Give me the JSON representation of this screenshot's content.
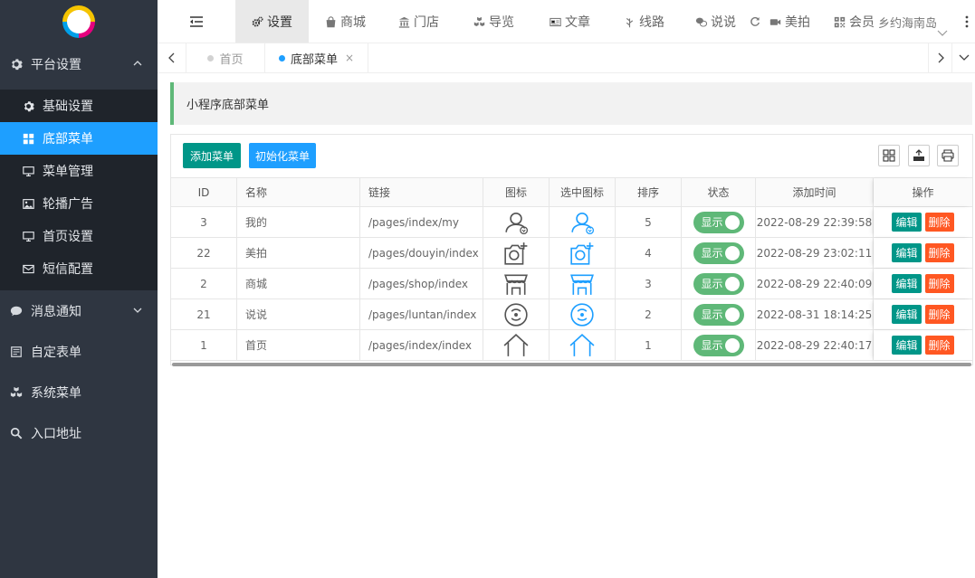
{
  "sidebar": {
    "groups": [
      {
        "label": "平台设置",
        "icon": "gear-icon",
        "expanded": true
      },
      {
        "label": "消息通知",
        "icon": "chat-bubble-icon",
        "expanded": false
      },
      {
        "label": "自定表单",
        "icon": "form-icon"
      },
      {
        "label": "系统菜单",
        "icon": "cubes-icon"
      },
      {
        "label": "入口地址",
        "icon": "search-icon"
      }
    ],
    "items": [
      {
        "label": "基础设置",
        "icon": "gear-icon"
      },
      {
        "label": "底部菜单",
        "icon": "grid-icon",
        "active": true
      },
      {
        "label": "菜单管理",
        "icon": "monitor-icon"
      },
      {
        "label": "轮播广告",
        "icon": "image-icon"
      },
      {
        "label": "首页设置",
        "icon": "monitor-icon"
      },
      {
        "label": "短信配置",
        "icon": "envelope-icon"
      }
    ]
  },
  "topnav": {
    "items": [
      {
        "label": "设置",
        "icon": "gears-icon",
        "active": true
      },
      {
        "label": "商城",
        "icon": "shopping-bag-icon"
      },
      {
        "label": "门店",
        "icon": "bank-icon"
      },
      {
        "label": "导览",
        "icon": "cubes-icon"
      },
      {
        "label": "文章",
        "icon": "newspaper-icon"
      },
      {
        "label": "线路",
        "icon": "leaf-icon"
      },
      {
        "label": "说说",
        "icon": "wechat-icon"
      },
      {
        "label": "美拍",
        "icon": "video-camera-icon"
      },
      {
        "label": "会员",
        "icon": "qrcode-icon"
      }
    ],
    "site_name": "乡约海南岛"
  },
  "tabs": [
    {
      "label": "首页",
      "active": false
    },
    {
      "label": "底部菜单",
      "active": true,
      "close": "×"
    }
  ],
  "page": {
    "title": "小程序底部菜单"
  },
  "toolbar": {
    "add_label": "添加菜单",
    "init_label": "初始化菜单"
  },
  "table": {
    "columns": [
      "ID",
      "名称",
      "链接",
      "图标",
      "选中图标",
      "排序",
      "状态",
      "添加时间",
      "操作"
    ],
    "rows": [
      {
        "id": "3",
        "name": "我的",
        "link": "/pages/index/my",
        "icon": "user-icon",
        "sort": "5",
        "status": "显示",
        "time": "2022-08-29 22:39:58"
      },
      {
        "id": "22",
        "name": "美拍",
        "link": "/pages/douyin/index",
        "icon": "camera-plus-icon",
        "sort": "4",
        "status": "显示",
        "time": "2022-08-29 23:02:11"
      },
      {
        "id": "2",
        "name": "商城",
        "link": "/pages/shop/index",
        "icon": "store-icon",
        "sort": "3",
        "status": "显示",
        "time": "2022-08-29 22:40:09"
      },
      {
        "id": "21",
        "name": "说说",
        "link": "/pages/luntan/index",
        "icon": "signal-circle-icon",
        "sort": "2",
        "status": "显示",
        "time": "2022-08-31 18:14:25"
      },
      {
        "id": "1",
        "name": "首页",
        "link": "/pages/index/index",
        "icon": "house-icon",
        "sort": "1",
        "status": "显示",
        "time": "2022-08-29 22:40:17"
      }
    ],
    "edit_label": "编辑",
    "delete_label": "删除"
  },
  "colors": {
    "sidebar_bg": "#2f3641",
    "active_blue": "#1e9fff",
    "teal": "#009688",
    "green": "#5fb878",
    "orange": "#ff5722",
    "icon_gray": "#555555",
    "icon_blue": "#1e9fff"
  }
}
